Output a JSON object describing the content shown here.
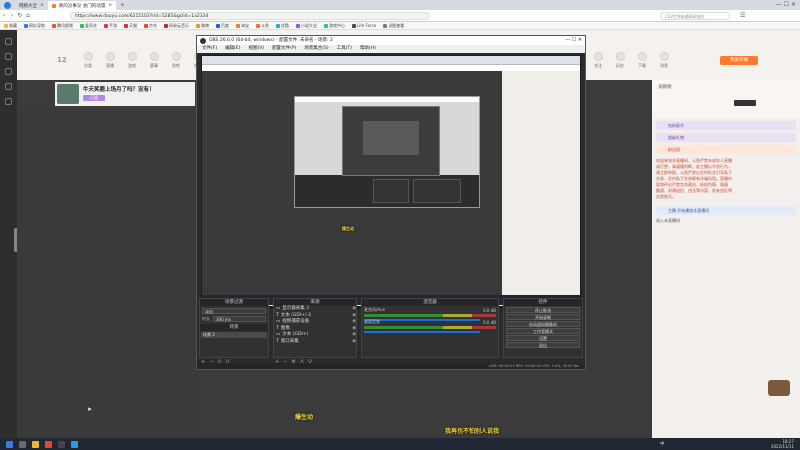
{
  "browser": {
    "tabs": [
      {
        "label": "网络大全",
        "active": false
      },
      {
        "label": "真的没事没 会门的动漫",
        "active": true
      }
    ],
    "url": "https://www.douyu.com/6215103?rid=5285&gclid=1a2334",
    "search_placeholder": "CS2世界级最精彩操作",
    "bookmarks": [
      {
        "label": "收藏",
        "color": "#f2b632"
      },
      {
        "label": "网址导航",
        "color": "#2a7be4"
      },
      {
        "label": "腾讯视频",
        "color": "#e4572a"
      },
      {
        "label": "爱奇艺",
        "color": "#2ac44a"
      },
      {
        "label": "手游",
        "color": "#e42a5c"
      },
      {
        "label": "天猫",
        "color": "#e42a2a"
      },
      {
        "label": "京东",
        "color": "#e44a2a"
      },
      {
        "label": "网易云音乐",
        "color": "#c22a2a"
      },
      {
        "label": "微博",
        "color": "#e49a2a"
      },
      {
        "label": "百度",
        "color": "#2a5ae4"
      },
      {
        "label": "淘宝",
        "color": "#f27a2a"
      },
      {
        "label": "斗鱼",
        "color": "#f2762a"
      },
      {
        "label": "优酷",
        "color": "#2aa4e4"
      },
      {
        "label": "小说大全",
        "color": "#8a5ae4"
      },
      {
        "label": "游戏中心",
        "color": "#2ac48a"
      },
      {
        "label": "Life Force",
        "color": "#4a4a4a"
      },
      {
        "label": "试图查看",
        "color": "#7a7a7a"
      }
    ]
  },
  "douyu": {
    "header_icons": [
      "分类",
      "直播",
      "游戏",
      "赛事",
      "鱼吧",
      "视频"
    ],
    "header_right_icons": [
      "关注",
      "历史",
      "下载",
      "消息"
    ],
    "badge_count": "12",
    "live_button": "我要开播",
    "streamer_title": "牛天笑鹿上场月了吗？没有！",
    "subscribe_label": "订阅",
    "right_panel": {
      "rank_label": "贡献榜",
      "gifts": [
        "钻粉豪华",
        "超级礼物",
        "粉丝团"
      ],
      "messages": [
        "欢迎来到本直播间，斗鱼严禁未成年人直播",
        "或打赏，请谨慎判断，若主播以不良行为，",
        "请立即举报，斗鱼严禁以任何形式引导私下",
        "交易，任何私下交易都有诈骗风险。直播内",
        "容和评论严禁包含政治、低俗色情、吸烟",
        "酗酒、封建迷信、违法等内容，若有违反将",
        "封禁账号。"
      ],
      "join1": "主播 开始播放本直播间",
      "join2": "进入本直播间"
    }
  },
  "obs": {
    "title": "OBS 26.0.0 (64-bit, windows) - 配置文件: 未命名 - 场景: 2",
    "menu": [
      "文件(F)",
      "编辑(E)",
      "视图(V)",
      "配置文件(P)",
      "场景集合(S)",
      "工具(T)",
      "帮助(H)"
    ],
    "panels": {
      "scenes_title": "场景过渡",
      "sources_title": "来源",
      "mixer_title": "混音器",
      "controls_title": "控件"
    },
    "transition": {
      "label": "淡出",
      "duration_label": "时长",
      "duration": "300 ms"
    },
    "scene_header": "场景",
    "scene_item": "场景 2",
    "sources": [
      "显示器采集 2",
      "文本 (GDI+) 2",
      "视频捕获设备",
      "图像",
      "文本 (GDI+)",
      "窗口采集"
    ],
    "mixer": [
      {
        "name": "麦克风/Aux",
        "db": "0.0 dB"
      },
      {
        "name": "桌面音频",
        "db": "0.0 dB"
      }
    ],
    "controls": [
      "停止推流",
      "开始录制",
      "启动虚拟摄像机",
      "工作室模式",
      "设置",
      "退出"
    ],
    "status": "LIVE: 00:05:21   REC: 00:00:00   CPU: 3.4%, 30.00 fps",
    "rec_indicator": "停止推流"
  },
  "overlays": {
    "subtitle1": "爆生动",
    "subtitle2": "我再也不怕别人说我"
  },
  "taskbar": {
    "time": "18:27",
    "date": "2022/11/11",
    "lang": "中"
  },
  "colors": {
    "douyu_orange": "#ff7a2a",
    "obs_dark": "#2b2b2b",
    "subtitle_yellow": "#f4d33c"
  }
}
